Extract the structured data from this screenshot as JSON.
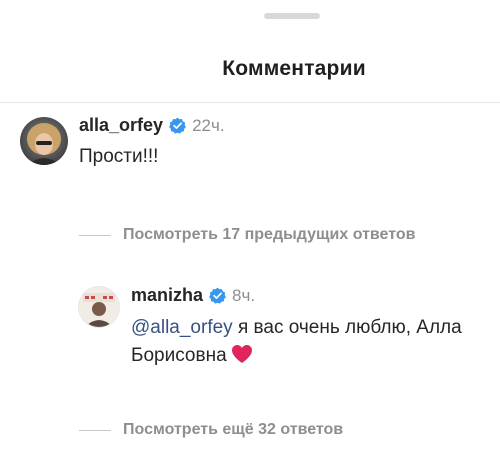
{
  "header": {
    "title": "Комментарии"
  },
  "comments": [
    {
      "username": "alla_orfey",
      "verified": true,
      "time": "22ч.",
      "text": "Прости!!!",
      "avatar_icon": "avatar-alla-photo"
    }
  ],
  "replies_toggle_prev": "Посмотреть 17 предыдущих ответов",
  "reply": {
    "username": "manizha",
    "verified": true,
    "time": "8ч.",
    "mention": "@alla_orfey",
    "text": " я вас очень люблю, Алла Борисовна",
    "emoji_icon": "red-heart-icon",
    "avatar_icon": "avatar-manizha-photo"
  },
  "replies_toggle_more": "Посмотреть ещё 32 ответов",
  "colors": {
    "verified_badge": "#3897f0",
    "mention": "#385185",
    "muted": "#8e8e8e",
    "heart": "#e0245e"
  }
}
